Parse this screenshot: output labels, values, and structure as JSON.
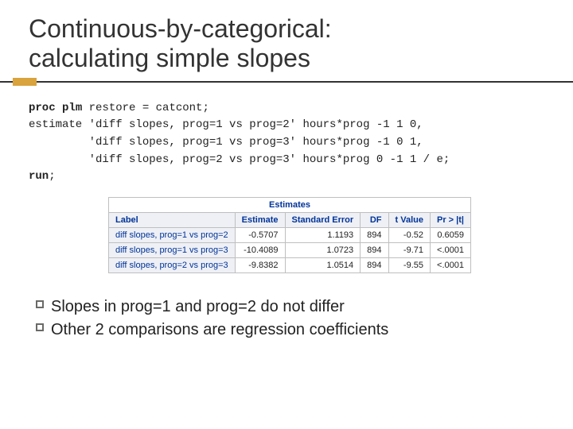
{
  "title_line1": "Continuous-by-categorical:",
  "title_line2": "calculating simple slopes",
  "code": {
    "kw_proc": "proc",
    "kw_plm": "plm",
    "line1_rest": " restore = catcont;",
    "line2": "estimate 'diff slopes, prog=1 vs prog=2' hours*prog -1 1 0,",
    "line3": "         'diff slopes, prog=1 vs prog=3' hours*prog -1 0 1,",
    "line4": "         'diff slopes, prog=2 vs prog=3' hours*prog 0 -1 1 / e;",
    "kw_run": "run",
    "run_semicolon": ";"
  },
  "chart_data": {
    "type": "table",
    "title": "Estimates",
    "columns": [
      "Label",
      "Estimate",
      "Standard Error",
      "DF",
      "t Value",
      "Pr > |t|"
    ],
    "rows": [
      {
        "label": "diff slopes, prog=1 vs prog=2",
        "estimate": "-0.5707",
        "stderr": "1.1193",
        "df": "894",
        "tvalue": "-0.52",
        "p": "0.6059"
      },
      {
        "label": "diff slopes, prog=1 vs prog=3",
        "estimate": "-10.4089",
        "stderr": "1.0723",
        "df": "894",
        "tvalue": "-9.71",
        "p": "<.0001"
      },
      {
        "label": "diff slopes, prog=2 vs prog=3",
        "estimate": "-9.8382",
        "stderr": "1.0514",
        "df": "894",
        "tvalue": "-9.55",
        "p": "<.0001"
      }
    ]
  },
  "bullets": [
    "Slopes in prog=1 and prog=2 do not differ",
    "Other 2 comparisons are regression coefficients"
  ]
}
